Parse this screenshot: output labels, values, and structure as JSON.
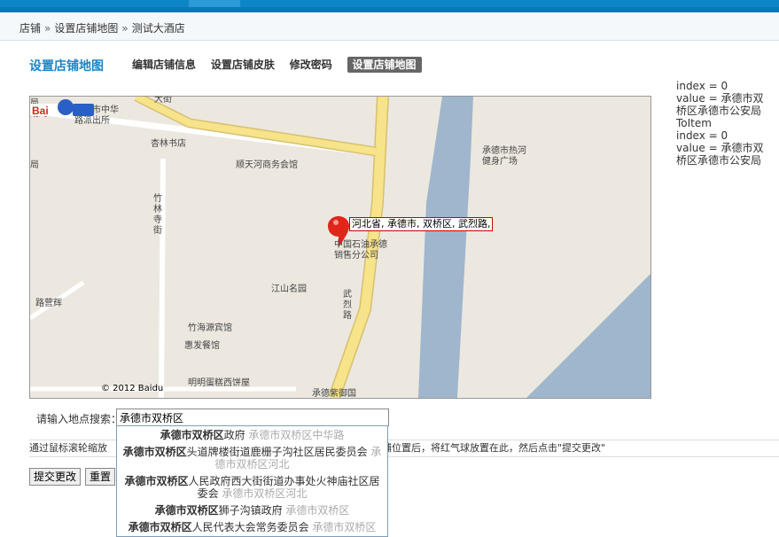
{
  "breadcrumb": [
    "店铺",
    "设置店铺地图",
    "测试大酒店"
  ],
  "breadcrumb_sep": "»",
  "page_title": "设置店铺地图",
  "nav": [
    {
      "label": "编辑店铺信息",
      "active": false
    },
    {
      "label": "设置店铺皮肤",
      "active": false
    },
    {
      "label": "修改密码",
      "active": false
    },
    {
      "label": "设置店铺地图",
      "active": true
    }
  ],
  "map": {
    "labels": {
      "l1": "局",
      "l2": "划局",
      "l3": "承德市中华",
      "l4": "路派出所",
      "l5": "大街",
      "l6": "杏林书店",
      "l7": "顺天河商务会馆",
      "l8": "承德市热河",
      "l9": "健身广场",
      "l10": "局",
      "l11": "竹林寺街",
      "l12": "中国石油承德",
      "l13": "销售分公司",
      "l14": "江山名园",
      "l15": "武烈路",
      "l16": "路营辉",
      "l17": "竹海源宾馆",
      "l18": "惠发餐馆",
      "l19": "明明蛋糕西饼屋",
      "l20": "承德紫御国"
    },
    "tooltip": "河北省, 承德市, 双桥区, 武烈路,",
    "logo_text": "Bai地图",
    "copyright": "© 2012 Baidu"
  },
  "debug_lines": [
    "index = 0",
    "value = 承德市双桥区承德市公安局",
    "ToItem",
    "index = 0",
    "value = 承德市双桥区承德市公安局"
  ],
  "search": {
    "label": "请输入地点搜索：",
    "value": "承德市双桥区"
  },
  "instruction": {
    "part1": "通过鼠标滚轮缩放",
    "part2": "铺位置后，将红气球放置在此，然后点击\"提交更改\""
  },
  "buttons": {
    "submit": "提交更改",
    "reset": "重置"
  },
  "suggestions": [
    {
      "bold": "承德市双桥区",
      "rest": "政府",
      "grey": "承德市双桥区中华路"
    },
    {
      "bold": "承德市双桥区",
      "rest": "头道牌楼街道鹿栅子沟社区居民委员会",
      "grey": "承德市双桥区河北"
    },
    {
      "bold": "承德市双桥区",
      "rest": "人民政府西大街街道办事处火神庙社区居委会",
      "grey": "承德市双桥区河北"
    },
    {
      "bold": "承德市双桥区",
      "rest": "狮子沟镇政府",
      "grey": "承德市双桥区"
    },
    {
      "bold": "承德市双桥区",
      "rest": "人民代表大会常务委员会",
      "grey": "承德市双桥区"
    }
  ],
  "colors": {
    "topbar": "#0d86c8",
    "title": "#1a86c6",
    "active_nav": "#666666",
    "road_yellow": "#f7e38a",
    "river": "#9fb6cc",
    "marker": "#e0261b"
  }
}
